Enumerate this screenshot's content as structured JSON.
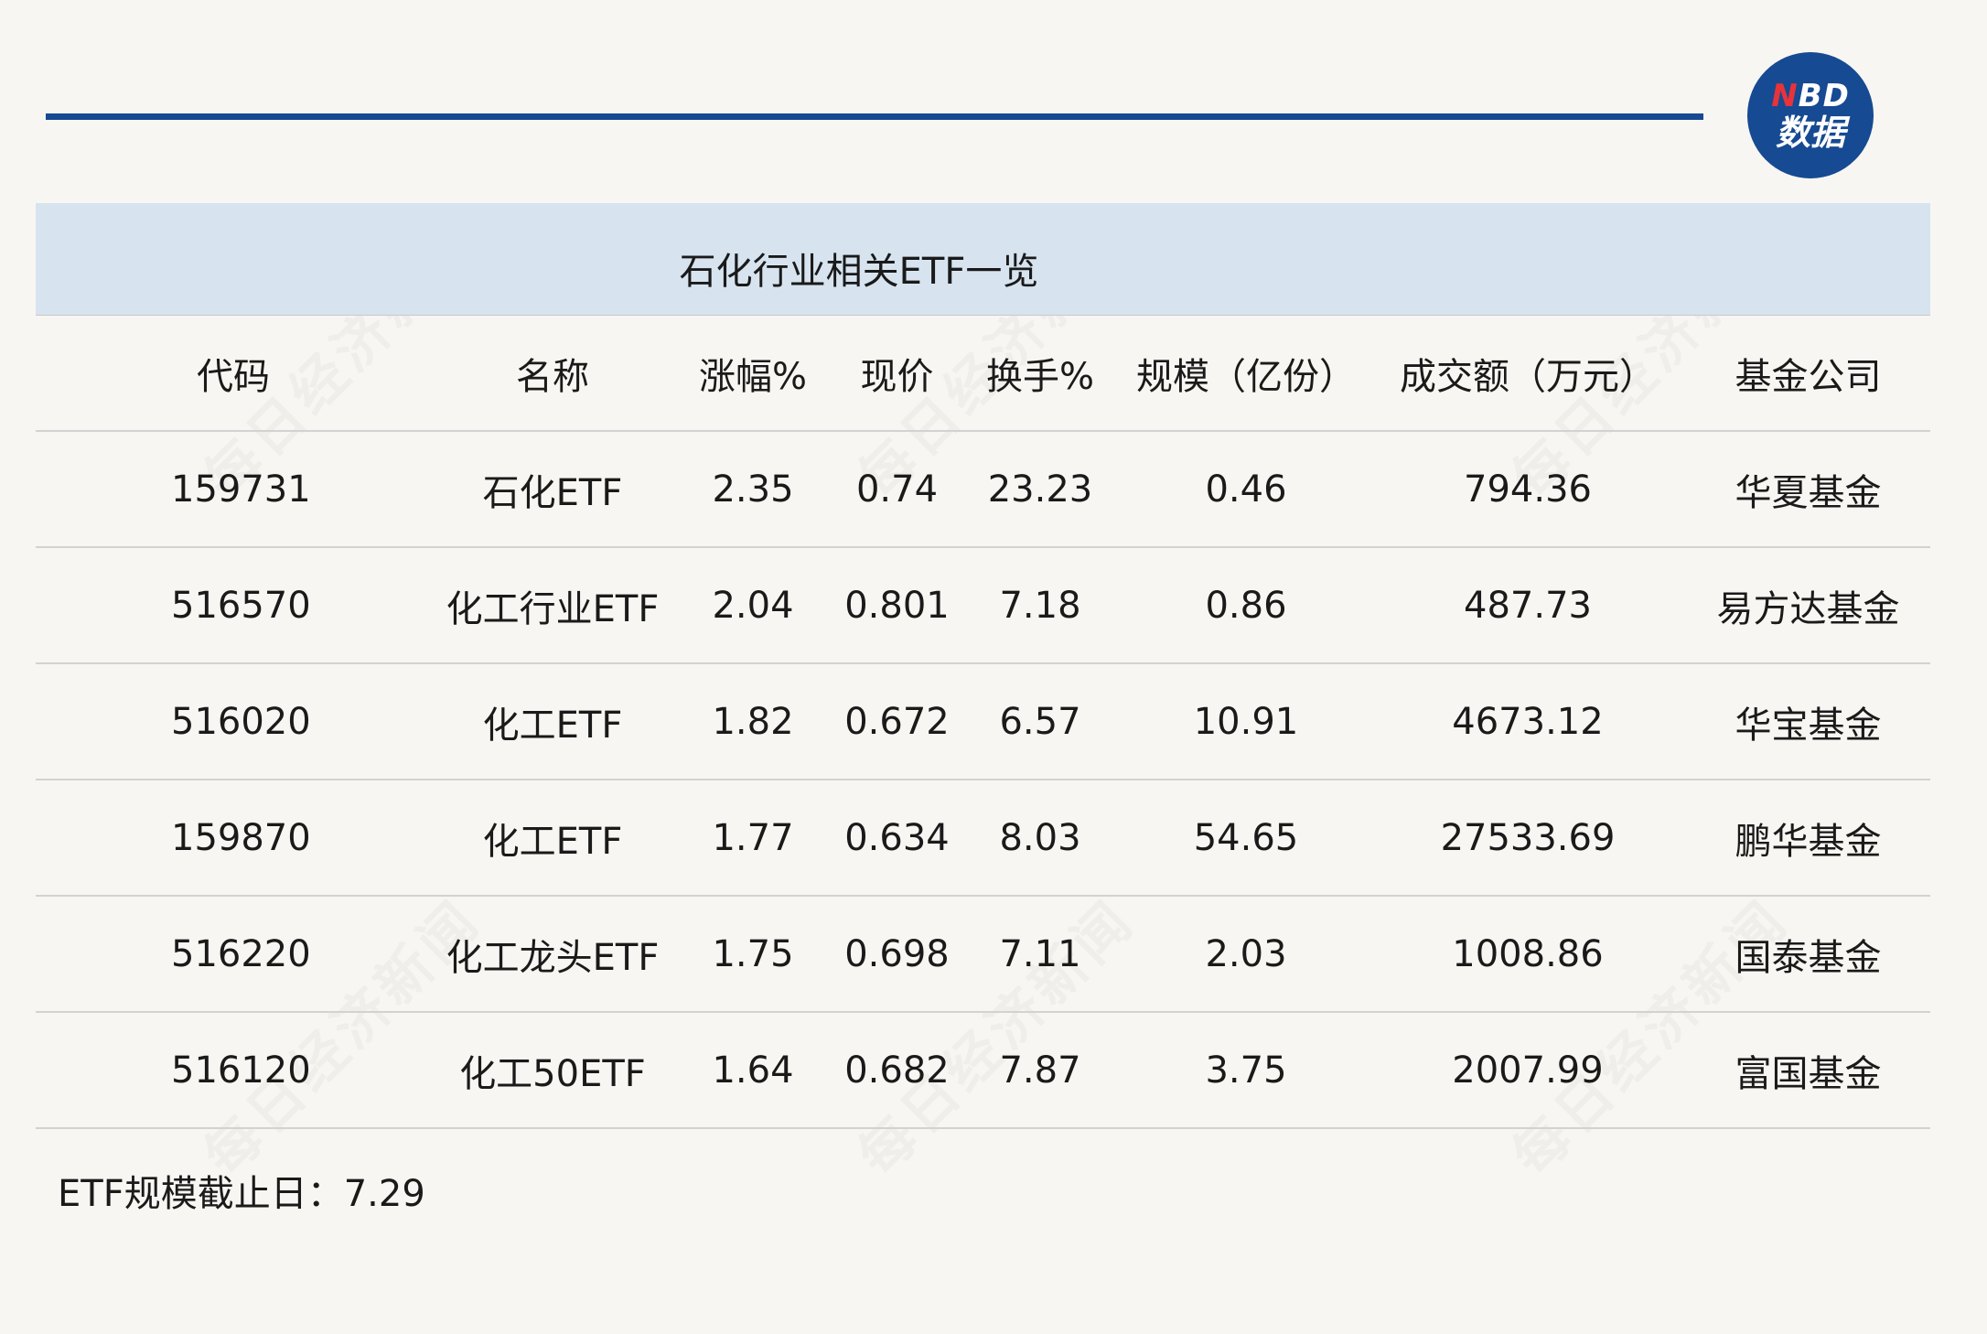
{
  "logo": {
    "line1_n": "N",
    "line1_rest": "BD",
    "line2": "数据"
  },
  "title": "石化行业相关ETF一览",
  "table": {
    "headers": [
      "代码",
      "名称",
      "涨幅%",
      "现价",
      "换手%",
      "规模（亿份）",
      "成交额（万元）",
      "基金公司"
    ],
    "rows": [
      [
        "159731",
        "石化ETF",
        "2.35",
        "0.74",
        "23.23",
        "0.46",
        "794.36",
        "华夏基金"
      ],
      [
        "516570",
        "化工行业ETF",
        "2.04",
        "0.801",
        "7.18",
        "0.86",
        "487.73",
        "易方达基金"
      ],
      [
        "516020",
        "化工ETF",
        "1.82",
        "0.672",
        "6.57",
        "10.91",
        "4673.12",
        "华宝基金"
      ],
      [
        "159870",
        "化工ETF",
        "1.77",
        "0.634",
        "8.03",
        "54.65",
        "27533.69",
        "鹏华基金"
      ],
      [
        "516220",
        "化工龙头ETF",
        "1.75",
        "0.698",
        "7.11",
        "2.03",
        "1008.86",
        "国泰基金"
      ],
      [
        "516120",
        "化工50ETF",
        "1.64",
        "0.682",
        "7.87",
        "3.75",
        "2007.99",
        "富国基金"
      ]
    ]
  },
  "footnote": "ETF规模截止日：7.29",
  "watermark_text": "每日经济新闻",
  "colors": {
    "accent": "#164a92",
    "logo_red": "#e8333a",
    "title_band": "#d7e4ef",
    "background": "#f8f6f2"
  }
}
